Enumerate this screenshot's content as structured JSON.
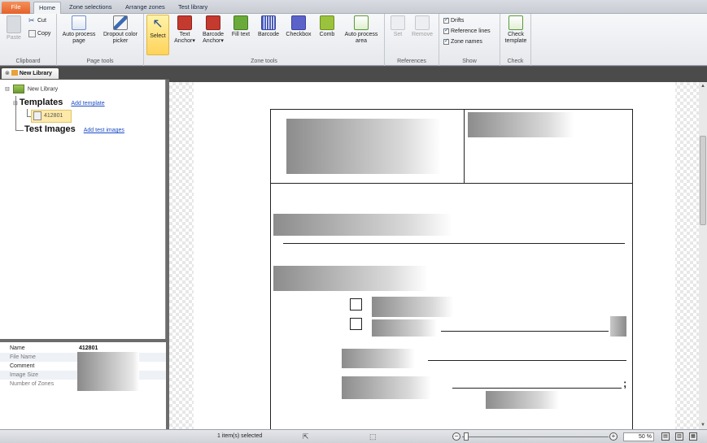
{
  "ribbon_tabs": [
    "File",
    "Home",
    "Zone selections",
    "Arrange zones",
    "Test library"
  ],
  "active_tab": "Home",
  "clipboard": {
    "paste": "Paste",
    "cut": "Cut",
    "copy": "Copy",
    "label": "Clipboard"
  },
  "page_tools": {
    "auto_process_page": "Auto process page",
    "dropout_color_picker": "Dropout color picker",
    "label": "Page tools"
  },
  "zone_tools": {
    "select": "Select",
    "text_anchor": "Text Anchor",
    "barcode_anchor": "Barcode Anchor",
    "fill_text": "Fill text",
    "barcode": "Barcode",
    "checkbox": "Checkbox",
    "comb": "Comb",
    "auto_process_area": "Auto process area",
    "label": "Zone tools"
  },
  "references": {
    "set": "Set",
    "remove": "Remove",
    "label": "References"
  },
  "show": {
    "drifts": "Drifts",
    "reference_lines": "Reference lines",
    "zone_names": "Zone names",
    "label": "Show"
  },
  "check": {
    "check_template": "Check template",
    "label": "Check"
  },
  "doc_tab": {
    "title": "New Library"
  },
  "tree": {
    "root": "New Library",
    "templates": "Templates",
    "add_template": "Add template",
    "template_item": "412801",
    "test_images": "Test Images",
    "add_test_images": "Add test images"
  },
  "properties": [
    {
      "name": "Name",
      "value": "412801",
      "muted": false
    },
    {
      "name": "File Name",
      "value": "",
      "muted": true
    },
    {
      "name": "Comment",
      "value": "",
      "muted": false
    },
    {
      "name": "Image Size",
      "value": "",
      "muted": true
    },
    {
      "name": "Number of Zones",
      "value": "",
      "muted": true
    }
  ],
  "canvas": {
    "semicolon": ";"
  },
  "status": {
    "selection": "1 item(s) selected",
    "zoom": "50 %"
  },
  "colors": {
    "file_tab": "#e4612a",
    "select_highlight": "#ffd35a",
    "link": "#1b4cc4",
    "template_highlight": "#fde9a8"
  }
}
